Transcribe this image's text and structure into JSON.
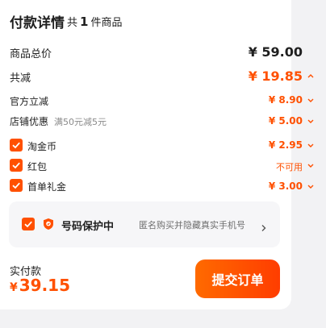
{
  "header": {
    "title": "付款详情",
    "count_prefix": "共",
    "count": "1",
    "count_suffix": "件商品"
  },
  "summary": {
    "goods_total_label": "商品总价",
    "goods_total_value": "¥ 59.00",
    "discount_total_label": "共减",
    "discount_total_value": "¥ 19.85"
  },
  "discounts": {
    "official_label": "官方立减",
    "official_value": "¥ 8.90",
    "store_label": "店铺优惠",
    "store_note": "满50元减5元",
    "store_value": "¥ 5.00",
    "taojinbi_label": "淘金币",
    "taojinbi_value": "¥ 2.95",
    "hongbao_label": "红包",
    "hongbao_value": "不可用",
    "first_order_label": "首单礼金",
    "first_order_value": "¥ 3.00"
  },
  "protection": {
    "title": "号码保护中",
    "description": "匿名购买并隐藏真实手机号"
  },
  "footer": {
    "pay_label": "实付款",
    "currency": "¥",
    "pay_amount": "39.15",
    "submit_label": "提交订单"
  },
  "colors": {
    "accent": "#ff5000",
    "background": "#f2f2f4",
    "card": "#ffffff"
  },
  "icons": [
    "checkmark-icon",
    "chevron-down-icon",
    "chevron-up-icon",
    "chevron-right-icon",
    "shield-icon"
  ]
}
